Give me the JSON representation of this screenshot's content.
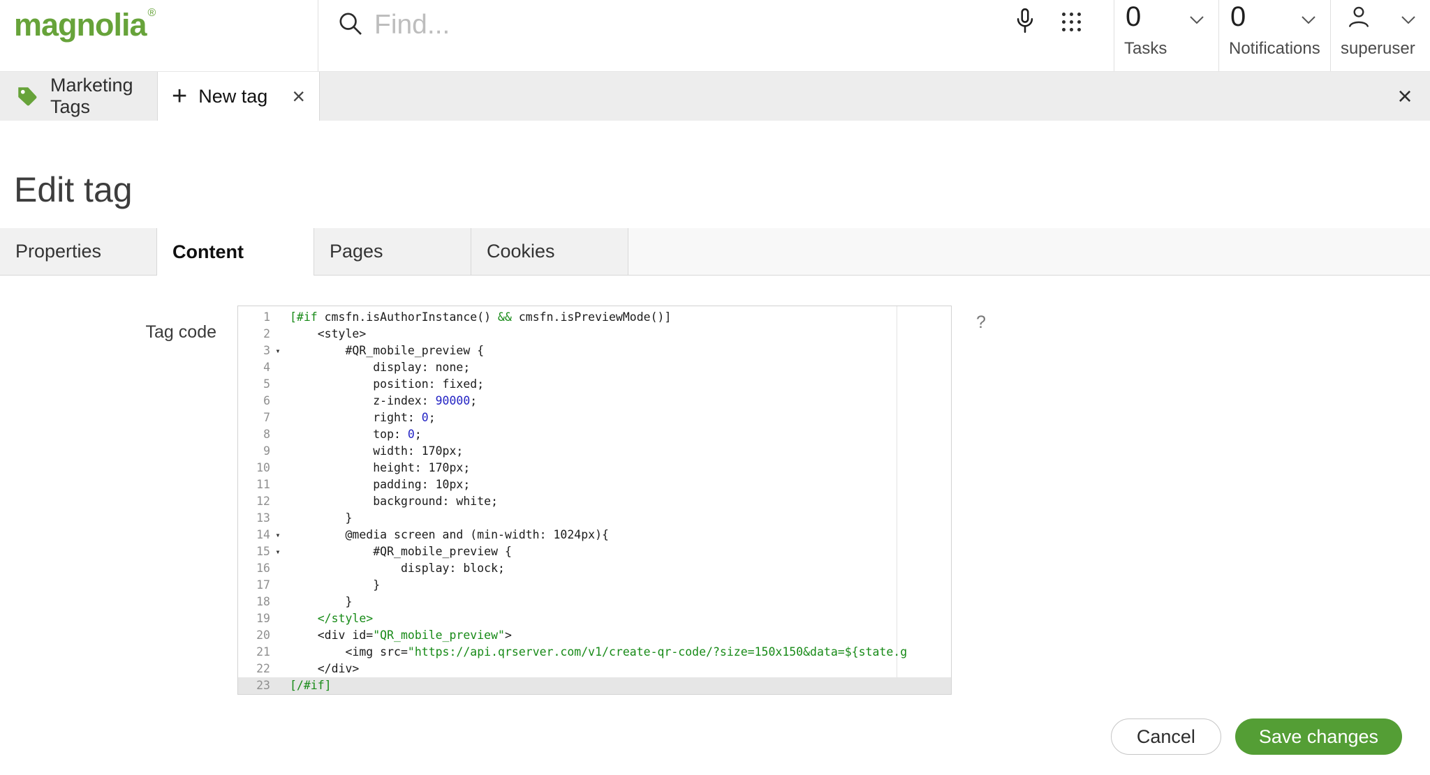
{
  "topbar": {
    "logo": "magnolia",
    "registered_mark": "®",
    "search": {
      "placeholder": "Find..."
    },
    "tasks": {
      "count": "0",
      "label": "Tasks"
    },
    "notifications": {
      "count": "0",
      "label": "Notifications"
    },
    "user": {
      "name": "superuser"
    }
  },
  "app_tabbar": {
    "marketing_tags_tab": {
      "label": "Marketing Tags"
    },
    "new_tag_tab": {
      "label": "New tag",
      "plus": "+",
      "close": "×"
    },
    "close": "×"
  },
  "subapp": {
    "title": "Edit tag",
    "tabs": [
      {
        "label": "Properties",
        "active": false
      },
      {
        "label": "Content",
        "active": true
      },
      {
        "label": "Pages",
        "active": false
      },
      {
        "label": "Cookies",
        "active": false
      }
    ],
    "field_label": "Tag code",
    "help": "?",
    "cancel_label": "Cancel",
    "save_label": "Save changes"
  },
  "colors": {
    "brand_green": "#67a33a",
    "button_green": "#549e35",
    "code_green": "#178a17",
    "code_blue": "#2424c4"
  },
  "code_editor": {
    "active_line": 23,
    "lines": [
      {
        "n": 1,
        "fold": false,
        "segs": [
          {
            "t": "[#if ",
            "c": "g"
          },
          {
            "t": "cmsfn.isAuthorInstance() ",
            "c": "k"
          },
          {
            "t": "&& ",
            "c": "g"
          },
          {
            "t": "cmsfn.isPreviewMode()]",
            "c": "k"
          }
        ]
      },
      {
        "n": 2,
        "fold": false,
        "segs": [
          {
            "t": "    <style>",
            "c": "k"
          }
        ]
      },
      {
        "n": 3,
        "fold": true,
        "segs": [
          {
            "t": "        #QR_mobile_preview {",
            "c": "k"
          }
        ]
      },
      {
        "n": 4,
        "fold": false,
        "segs": [
          {
            "t": "            display: none;",
            "c": "k"
          }
        ]
      },
      {
        "n": 5,
        "fold": false,
        "segs": [
          {
            "t": "            position: fixed;",
            "c": "k"
          }
        ]
      },
      {
        "n": 6,
        "fold": false,
        "segs": [
          {
            "t": "            z-index: ",
            "c": "k"
          },
          {
            "t": "90000",
            "c": "b"
          },
          {
            "t": ";",
            "c": "k"
          }
        ]
      },
      {
        "n": 7,
        "fold": false,
        "segs": [
          {
            "t": "            right: ",
            "c": "k"
          },
          {
            "t": "0",
            "c": "b"
          },
          {
            "t": ";",
            "c": "k"
          }
        ]
      },
      {
        "n": 8,
        "fold": false,
        "segs": [
          {
            "t": "            top: ",
            "c": "k"
          },
          {
            "t": "0",
            "c": "b"
          },
          {
            "t": ";",
            "c": "k"
          }
        ]
      },
      {
        "n": 9,
        "fold": false,
        "segs": [
          {
            "t": "            width: 170px;",
            "c": "k"
          }
        ]
      },
      {
        "n": 10,
        "fold": false,
        "segs": [
          {
            "t": "            height: 170px;",
            "c": "k"
          }
        ]
      },
      {
        "n": 11,
        "fold": false,
        "segs": [
          {
            "t": "            padding: 10px;",
            "c": "k"
          }
        ]
      },
      {
        "n": 12,
        "fold": false,
        "segs": [
          {
            "t": "            background: white;",
            "c": "k"
          }
        ]
      },
      {
        "n": 13,
        "fold": false,
        "segs": [
          {
            "t": "        }",
            "c": "k"
          }
        ]
      },
      {
        "n": 14,
        "fold": true,
        "segs": [
          {
            "t": "        @media screen and (min-width: 1024px){",
            "c": "k"
          }
        ]
      },
      {
        "n": 15,
        "fold": true,
        "segs": [
          {
            "t": "            #QR_mobile_preview {",
            "c": "k"
          }
        ]
      },
      {
        "n": 16,
        "fold": false,
        "segs": [
          {
            "t": "                display: block;",
            "c": "k"
          }
        ]
      },
      {
        "n": 17,
        "fold": false,
        "segs": [
          {
            "t": "            }",
            "c": "k"
          }
        ]
      },
      {
        "n": 18,
        "fold": false,
        "segs": [
          {
            "t": "        }",
            "c": "k"
          }
        ]
      },
      {
        "n": 19,
        "fold": false,
        "segs": [
          {
            "t": "    ",
            "c": "k"
          },
          {
            "t": "</style>",
            "c": "g"
          }
        ]
      },
      {
        "n": 20,
        "fold": false,
        "segs": [
          {
            "t": "    <div id=",
            "c": "k"
          },
          {
            "t": "\"QR_mobile_preview\"",
            "c": "g"
          },
          {
            "t": ">",
            "c": "k"
          }
        ]
      },
      {
        "n": 21,
        "fold": false,
        "segs": [
          {
            "t": "        <img src=",
            "c": "k"
          },
          {
            "t": "\"https://api.qrserver.com/v1/create-qr-code/?size=150x150&data=${state.g",
            "c": "g"
          }
        ]
      },
      {
        "n": 22,
        "fold": false,
        "segs": [
          {
            "t": "    </div>",
            "c": "k"
          }
        ]
      },
      {
        "n": 23,
        "fold": false,
        "segs": [
          {
            "t": "[/#if]",
            "c": "g"
          }
        ]
      }
    ]
  }
}
